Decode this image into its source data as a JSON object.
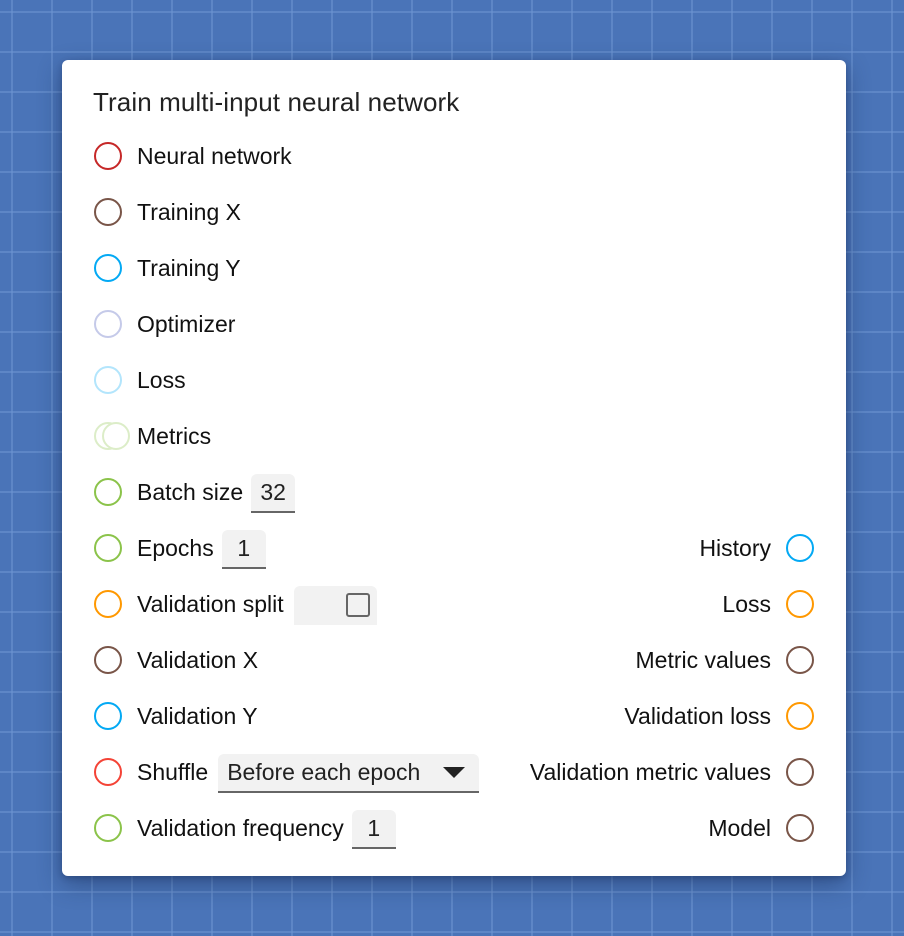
{
  "node": {
    "title": "Train multi-input neural network",
    "inputs": [
      {
        "label": "Neural network",
        "color": "#c62828",
        "multi": false
      },
      {
        "label": "Training X",
        "color": "#795548",
        "multi": false
      },
      {
        "label": "Training Y",
        "color": "#03a9f4",
        "multi": false
      },
      {
        "label": "Optimizer",
        "color": "#c5cae9",
        "multi": false
      },
      {
        "label": "Loss",
        "color": "#b3e5fc",
        "multi": false
      },
      {
        "label": "Metrics",
        "color": "#dcedc8",
        "multi": true
      },
      {
        "label": "Batch size",
        "color": "#8bc34a",
        "control": "number",
        "value": "32"
      },
      {
        "label": "Epochs",
        "color": "#8bc34a",
        "control": "number",
        "value": "1"
      },
      {
        "label": "Validation split",
        "color": "#ff9800",
        "control": "checkbox",
        "checked": false
      },
      {
        "label": "Validation X",
        "color": "#795548"
      },
      {
        "label": "Validation Y",
        "color": "#03a9f4"
      },
      {
        "label": "Shuffle",
        "color": "#f44336",
        "control": "select",
        "value": "Before each epoch"
      },
      {
        "label": "Validation frequency",
        "color": "#8bc34a",
        "control": "number",
        "value": "1"
      }
    ],
    "outputs": [
      {
        "label": "History",
        "color": "#03a9f4"
      },
      {
        "label": "Loss",
        "color": "#ff9800"
      },
      {
        "label": "Metric values",
        "color": "#795548"
      },
      {
        "label": "Validation loss",
        "color": "#ff9800"
      },
      {
        "label": "Validation metric values",
        "color": "#795548"
      },
      {
        "label": "Model",
        "color": "#795548"
      }
    ]
  },
  "colors": {
    "background": "#4a74b8",
    "card": "#ffffff"
  }
}
